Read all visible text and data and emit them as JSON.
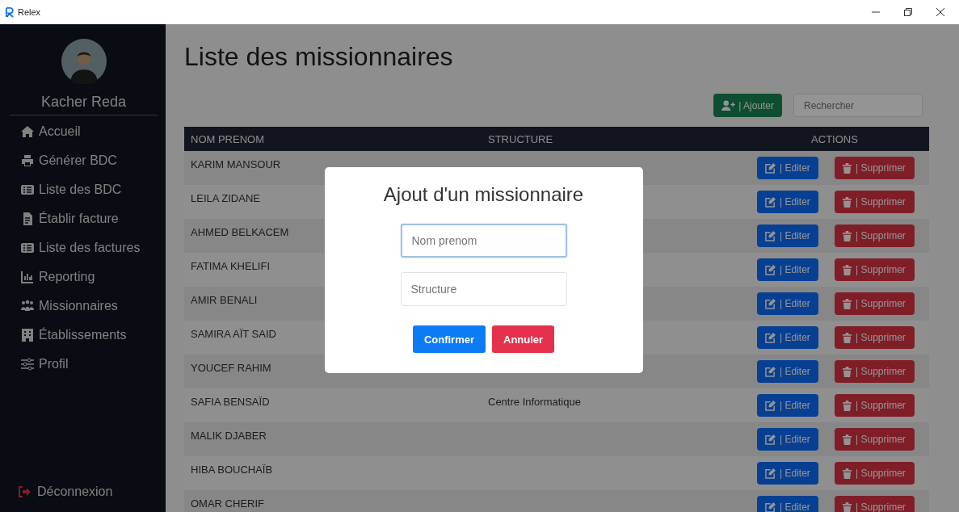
{
  "window": {
    "title": "Relex"
  },
  "sidebar": {
    "user_name": "Kacher Reda",
    "items": [
      {
        "label": "Accueil"
      },
      {
        "label": "Générer BDC"
      },
      {
        "label": "Liste des BDC"
      },
      {
        "label": "Établir facture"
      },
      {
        "label": "Liste des factures"
      },
      {
        "label": "Reporting"
      },
      {
        "label": "Missionnaires"
      },
      {
        "label": "Établissements"
      },
      {
        "label": "Profil"
      }
    ],
    "logout": "Déconnexion"
  },
  "page": {
    "title": "Liste des missionnaires",
    "add_button": "| Ajouter",
    "search": {
      "placeholder": "Rechercher"
    }
  },
  "table": {
    "columns": [
      "NOM PRENOM",
      "STRUCTURE",
      "ACTIONS"
    ],
    "rows": [
      {
        "name": "KARIM MANSOUR",
        "edit": "| Editer",
        "delete": "| Supprimer"
      },
      {
        "name": "LEILA ZIDANE",
        "edit": "| Editer",
        "delete": "| Supprimer"
      },
      {
        "name": "AHMED BELKACEM",
        "edit": "| Editer",
        "delete": "| Supprimer"
      },
      {
        "name": "FATIMA KHELIFI",
        "edit": "| Editer",
        "delete": "| Supprimer"
      },
      {
        "name": "AMIR BENALI",
        "edit": "| Editer",
        "delete": "| Supprimer"
      },
      {
        "name": "SAMIRA AÏT SAID",
        "edit": "| Editer",
        "delete": "| Supprimer"
      },
      {
        "name": "YOUCEF RAHIM",
        "edit": "| Editer",
        "delete": "| Supprimer"
      },
      {
        "name": "SAFIA BENSAÏD",
        "structure": "Centre Informatique",
        "edit": "| Editer",
        "delete": "| Supprimer"
      },
      {
        "name": "MALIK DJABER",
        "edit": "| Editer",
        "delete": "| Supprimer"
      },
      {
        "name": "HIBA BOUCHAÏB",
        "edit": "| Editer",
        "delete": "| Supprimer"
      },
      {
        "name": "OMAR CHERIF",
        "edit": "| Editer",
        "delete": "| Supprimer"
      }
    ]
  },
  "modal": {
    "title": "Ajout d'un missionnaire",
    "fields": [
      {
        "placeholder": "Nom prenom",
        "focused": true
      },
      {
        "placeholder": "Structure",
        "focused": false
      }
    ],
    "buttons": [
      {
        "label": "Confirmer",
        "kind": "primary"
      },
      {
        "label": "Annuler",
        "kind": "danger"
      }
    ]
  }
}
